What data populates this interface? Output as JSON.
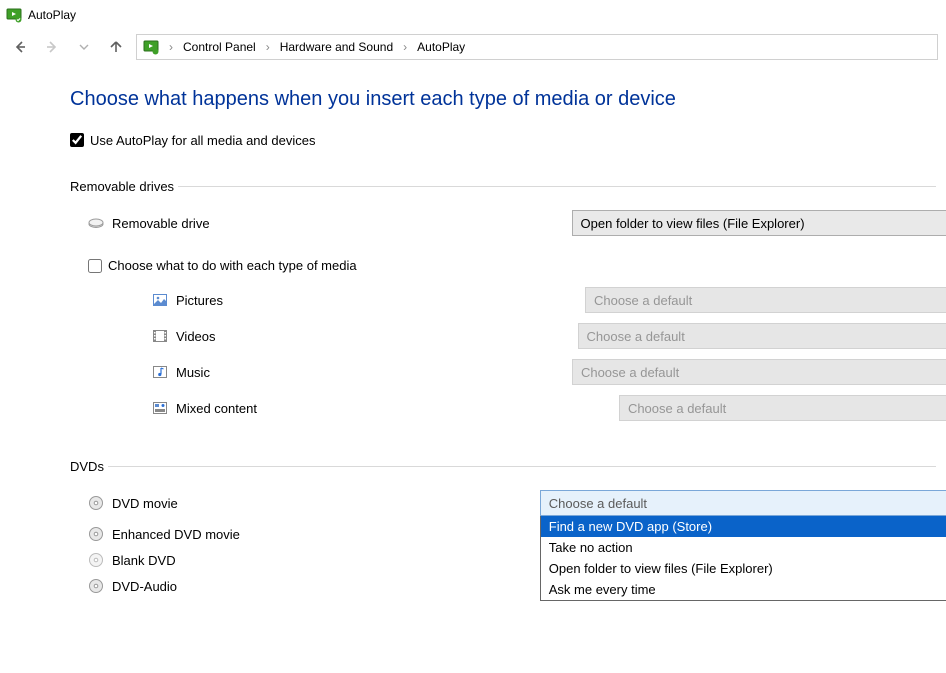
{
  "window": {
    "title": "AutoPlay"
  },
  "breadcrumb": {
    "items": [
      "Control Panel",
      "Hardware and Sound",
      "AutoPlay"
    ]
  },
  "heading": "Choose what happens when you insert each type of media or device",
  "use_autoplay_all": {
    "label": "Use AutoPlay for all media and devices",
    "checked": true
  },
  "sections": {
    "removable": {
      "legend": "Removable drives",
      "drive_label": "Removable drive",
      "drive_value": "Open folder to view files (File Explorer)",
      "per_media": {
        "label": "Choose what to do with each type of media",
        "checked": false
      },
      "media": [
        {
          "label": "Pictures",
          "value": "Choose a default"
        },
        {
          "label": "Videos",
          "value": "Choose a default"
        },
        {
          "label": "Music",
          "value": "Choose a default"
        },
        {
          "label": "Mixed content",
          "value": "Choose a default"
        }
      ]
    },
    "dvds": {
      "legend": "DVDs",
      "items": [
        {
          "label": "DVD movie"
        },
        {
          "label": "Enhanced DVD movie"
        },
        {
          "label": "Blank DVD"
        },
        {
          "label": "DVD-Audio"
        }
      ],
      "open_dropdown": {
        "placeholder": "Choose a default",
        "options": [
          "Find a new DVD app (Store)",
          "Take no action",
          "Open folder to view files (File Explorer)",
          "Ask me every time"
        ],
        "highlighted_index": 0
      }
    }
  }
}
